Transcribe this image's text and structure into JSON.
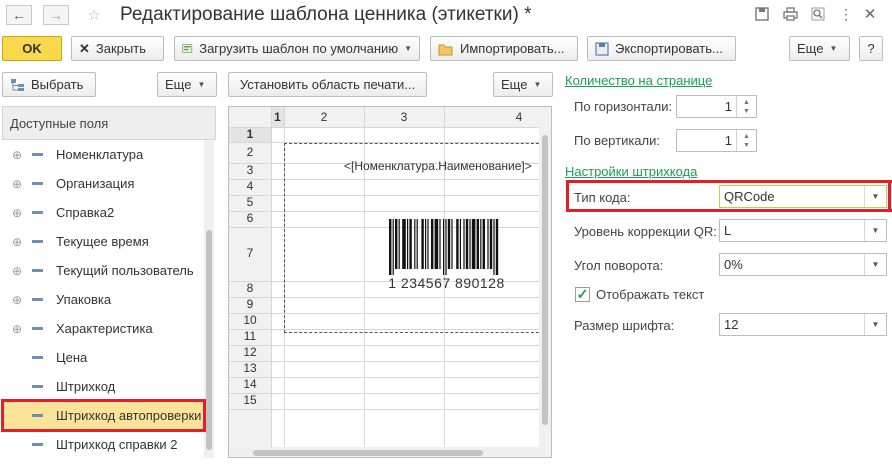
{
  "window": {
    "title": "Редактирование шаблона ценника (этикетки) *"
  },
  "toolbar": {
    "ok_label": "OK",
    "close_label": "Закрыть",
    "load_default_label": "Загрузить шаблон по умолчанию",
    "import_label": "Импортировать...",
    "export_label": "Экспортировать...",
    "more_label": "Еще"
  },
  "left_panel": {
    "select_label": "Выбрать",
    "more_label": "Еще",
    "header": "Доступные поля",
    "items": [
      {
        "label": "Номенклатура",
        "expandable": true
      },
      {
        "label": "Организация",
        "expandable": true
      },
      {
        "label": "Справка2",
        "expandable": true
      },
      {
        "label": "Текущее время",
        "expandable": true
      },
      {
        "label": "Текущий пользователь",
        "expandable": true
      },
      {
        "label": "Упаковка",
        "expandable": true
      },
      {
        "label": "Характеристика",
        "expandable": true
      },
      {
        "label": "Цена",
        "expandable": false
      },
      {
        "label": "Штрихкод",
        "expandable": false
      },
      {
        "label": "Штрихкод автопроверки",
        "expandable": false,
        "selected": true
      },
      {
        "label": "Штрихкод справки 2",
        "expandable": false
      }
    ]
  },
  "middle_panel": {
    "set_print_area_label": "Установить область печати...",
    "more_label": "Еще",
    "columns": [
      "1",
      "2",
      "3",
      "4"
    ],
    "rows": [
      "1",
      "2",
      "3",
      "4",
      "5",
      "6",
      "7",
      "8",
      "9",
      "10",
      "11",
      "12",
      "13",
      "14",
      "15"
    ],
    "cell_text": "<[Номенклатура.Наименование]>",
    "barcode_number": "1 234567 890128"
  },
  "right_panel": {
    "count_section": "Количество на странице",
    "horizontal_label": "По горизонтали:",
    "horizontal_value": "1",
    "vertical_label": "По вертикали:",
    "vertical_value": "1",
    "barcode_section": "Настройки штрихкода",
    "code_type_label": "Тип кода:",
    "code_type_value": "QRCode",
    "qr_level_label": "Уровень коррекции QR:",
    "qr_level_value": "L",
    "rotation_label": "Угол поворота:",
    "rotation_value": "0%",
    "show_text_label": "Отображать текст",
    "show_text_checked": true,
    "font_size_label": "Размер шрифта:",
    "font_size_value": "12"
  },
  "colors": {
    "ok_button": "#f8d94e",
    "selection": "#fbe49a",
    "highlight_box": "#e01f26",
    "section_link": "#1b9d58"
  }
}
